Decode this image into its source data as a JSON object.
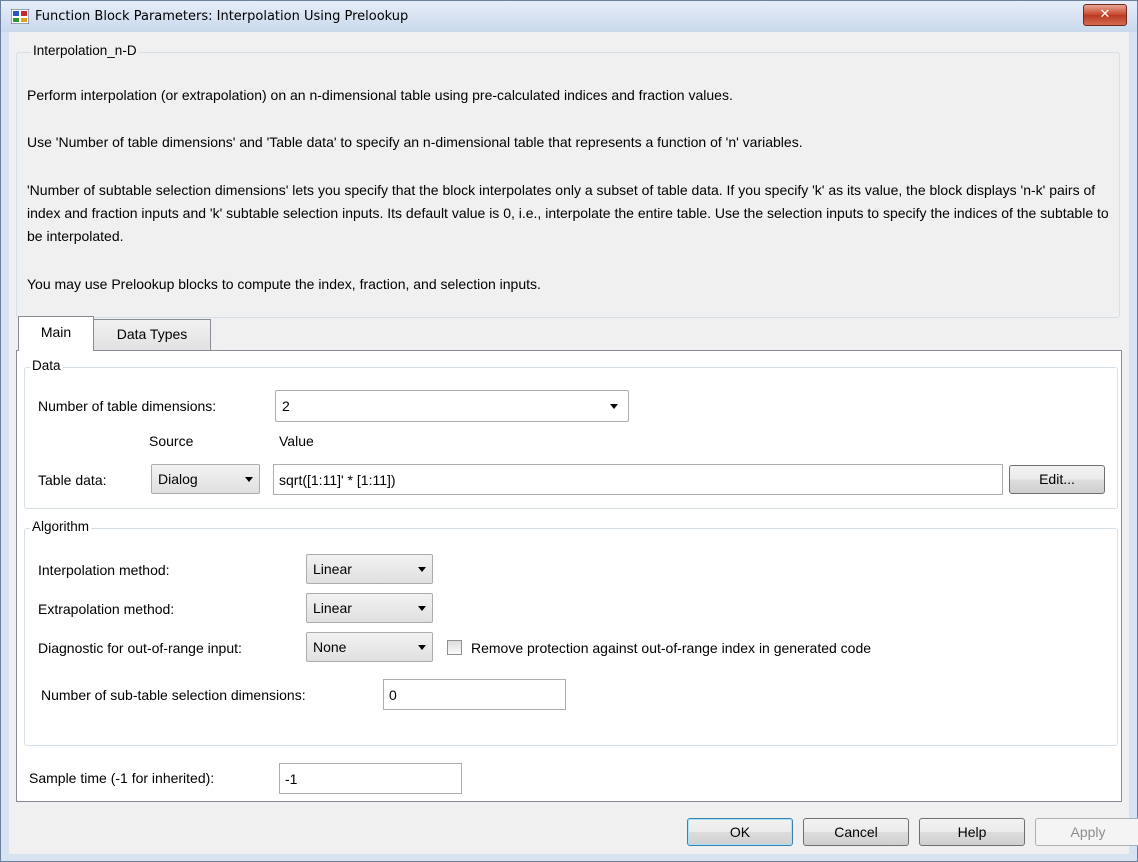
{
  "window": {
    "title": "Function Block Parameters: Interpolation Using Prelookup",
    "close_label": "✕"
  },
  "description": {
    "legend": "Interpolation_n-D",
    "paragraphs": [
      "Perform interpolation (or extrapolation) on an n-dimensional table using pre-calculated indices and fraction values.",
      "Use 'Number of table dimensions' and 'Table data' to specify an n-dimensional table that represents a function of 'n' variables.",
      "'Number of subtable selection dimensions' lets you specify that the block interpolates only a subset of table data. If you specify 'k' as its value, the block displays 'n-k' pairs of index and fraction inputs and 'k' subtable selection inputs. Its default value is 0, i.e., interpolate the entire table. Use the selection inputs to specify the indices of the subtable to be interpolated.",
      "You may use Prelookup blocks to compute the index, fraction, and selection inputs."
    ]
  },
  "tabs": [
    {
      "label": "Main",
      "active": true
    },
    {
      "label": "Data Types",
      "active": false
    }
  ],
  "data_group": {
    "legend": "Data",
    "num_dims_label": "Number of table dimensions:",
    "num_dims_value": "2",
    "source_header": "Source",
    "value_header": "Value",
    "table_data_label": "Table data:",
    "table_data_source": "Dialog",
    "table_data_value": "sqrt([1:11]' * [1:11])",
    "edit_label": "Edit..."
  },
  "algorithm_group": {
    "legend": "Algorithm",
    "interp_label": "Interpolation method:",
    "interp_value": "Linear",
    "extrap_label": "Extrapolation method:",
    "extrap_value": "Linear",
    "diag_label": "Diagnostic for out-of-range input:",
    "diag_value": "None",
    "remove_protection_label": "Remove protection against out-of-range index in generated code",
    "remove_protection_checked": false,
    "subtable_label": "Number of sub-table selection dimensions:",
    "subtable_value": "0"
  },
  "sample_time": {
    "label": "Sample time (-1 for inherited):",
    "value": "-1"
  },
  "buttons": {
    "ok": "OK",
    "cancel": "Cancel",
    "help": "Help",
    "apply": "Apply"
  }
}
